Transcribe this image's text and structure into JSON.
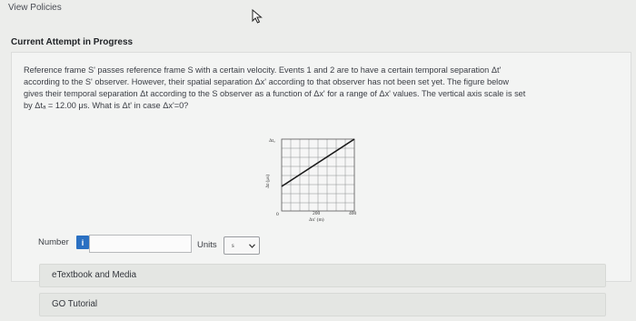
{
  "header": {
    "view_policies": "View Policies"
  },
  "attempt": {
    "heading": "Current Attempt in Progress"
  },
  "question": {
    "lines": [
      "Reference frame S' passes reference frame S with a certain velocity. Events 1 and 2 are to have a certain temporal separation Δt'",
      "according to the S' observer. However, their spatial separation Δx' according to that observer has not been set yet. The figure below",
      "gives their temporal separation Δt according to the S observer as a function of Δx' for a range of Δx' values. The vertical axis scale is set",
      "by Δtₐ = 12.00 μs. What is Δt' in case Δx'=0?"
    ]
  },
  "graph": {
    "y_axis_top_label": "Δtₐ",
    "y_axis_title": "Δt (μs)",
    "x_origin_label": "0",
    "x_tick_mid": "200",
    "x_tick_end": "400",
    "x_axis_title": "Δx' (m)"
  },
  "answer": {
    "number_label": "Number",
    "info_badge": "i",
    "number_value": "",
    "units_label": "Units",
    "units_selected": "s"
  },
  "resources": {
    "etextbook": "eTextbook and Media",
    "go_tutorial": "GO Tutorial"
  },
  "colors": {
    "info_blue": "#2a70c2",
    "line": "#1a1a1a"
  }
}
